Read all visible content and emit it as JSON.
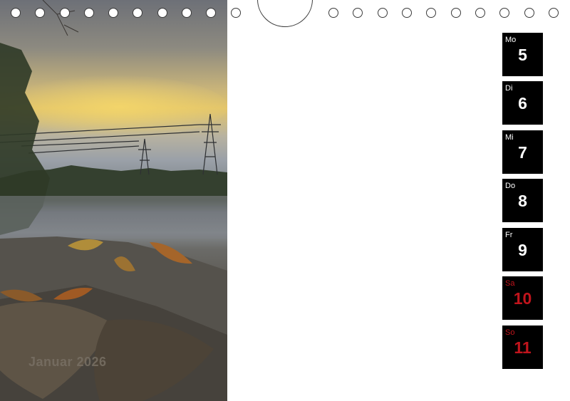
{
  "calendar": {
    "month_label": "Januar 2026",
    "days": [
      {
        "name": "Mo",
        "num": "5",
        "weekend": false
      },
      {
        "name": "Di",
        "num": "6",
        "weekend": false
      },
      {
        "name": "Mi",
        "num": "7",
        "weekend": false
      },
      {
        "name": "Do",
        "num": "8",
        "weekend": false
      },
      {
        "name": "Fr",
        "num": "9",
        "weekend": false
      },
      {
        "name": "Sa",
        "num": "10",
        "weekend": true
      },
      {
        "name": "So",
        "num": "11",
        "weekend": true
      }
    ]
  },
  "colors": {
    "day_box": "#000000",
    "weekday_text": "#ffffff",
    "weekend_text": "#c0141c"
  }
}
